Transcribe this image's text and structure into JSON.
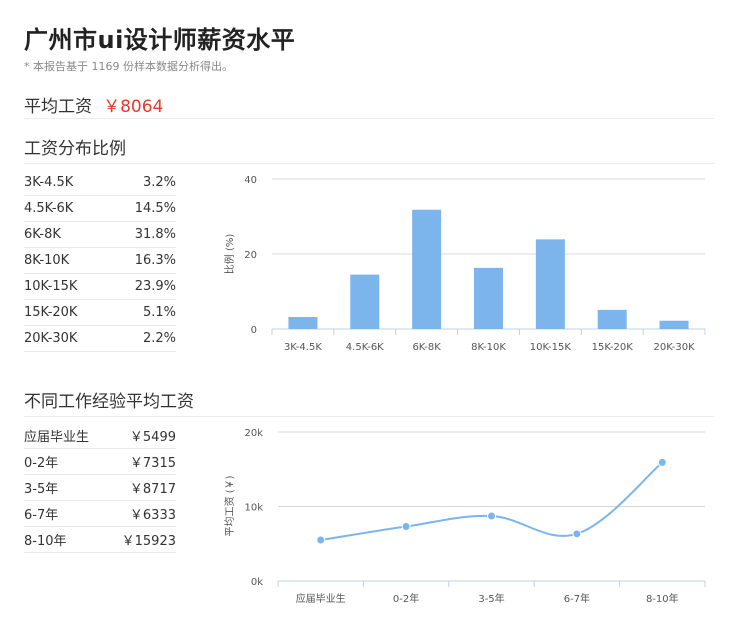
{
  "page": {
    "title": "广州市ui设计师薪资水平",
    "note": "* 本报告基于 1169 份样本数据分析得出。",
    "avg_label": "平均工资",
    "avg_value": "￥8064"
  },
  "distribution": {
    "title": "工资分布比例",
    "rows": [
      {
        "range": "3K-4.5K",
        "pct": "3.2%"
      },
      {
        "range": "4.5K-6K",
        "pct": "14.5%"
      },
      {
        "range": "6K-8K",
        "pct": "31.8%"
      },
      {
        "range": "8K-10K",
        "pct": "16.3%"
      },
      {
        "range": "10K-15K",
        "pct": "23.9%"
      },
      {
        "range": "15K-20K",
        "pct": "5.1%"
      },
      {
        "range": "20K-30K",
        "pct": "2.2%"
      }
    ]
  },
  "experience": {
    "title": "不同工作经验平均工资",
    "rows": [
      {
        "label": "应届毕业生",
        "salary": "￥5499"
      },
      {
        "label": "0-2年",
        "salary": "￥7315"
      },
      {
        "label": "3-5年",
        "salary": "￥8717"
      },
      {
        "label": "6-7年",
        "salary": "￥6333"
      },
      {
        "label": "8-10年",
        "salary": "￥15923"
      }
    ]
  },
  "chart_data": [
    {
      "type": "bar",
      "categories": [
        "3K-4.5K",
        "4.5K-6K",
        "6K-8K",
        "8K-10K",
        "10K-15K",
        "15K-20K",
        "20K-30K"
      ],
      "values": [
        3.2,
        14.5,
        31.8,
        16.3,
        23.9,
        5.1,
        2.2
      ],
      "ylabel": "比例 (%)",
      "yticks": [
        "0",
        "20",
        "40"
      ],
      "ylim": [
        0,
        40
      ],
      "grid": true,
      "color": "#7cb5ec"
    },
    {
      "type": "line",
      "categories": [
        "应届毕业生",
        "0-2年",
        "3-5年",
        "6-7年",
        "8-10年"
      ],
      "values": [
        5499,
        7315,
        8717,
        6333,
        15923
      ],
      "ylabel": "平均工资 (￥)",
      "yticks": [
        "0k",
        "10k",
        "20k"
      ],
      "ylim": [
        0,
        20000
      ],
      "grid": true,
      "smooth": true,
      "color": "#7cb5ec"
    }
  ]
}
